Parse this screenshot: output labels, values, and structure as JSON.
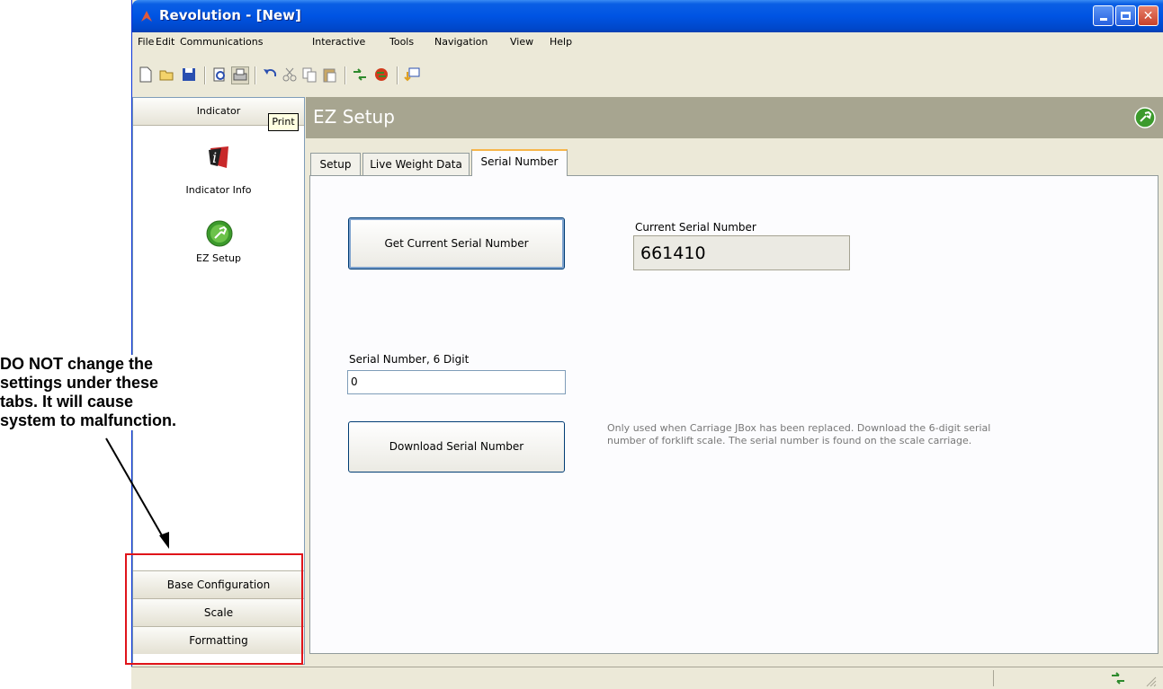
{
  "window": {
    "title": "Revolution - [New]",
    "controls": [
      "minimize",
      "maximize",
      "close"
    ]
  },
  "menu": [
    "File",
    "Edit",
    "Communications",
    "Interactive",
    "Tools",
    "Navigation",
    "View",
    "Help"
  ],
  "toolbar_icons": [
    "new-icon",
    "open-icon",
    "save-icon",
    "print-preview-icon",
    "print-icon",
    "undo-icon",
    "cut-icon",
    "copy-icon",
    "paste-icon",
    "connect-icon",
    "disconnect-icon",
    "download-icon"
  ],
  "tooltip": "Print",
  "nav": {
    "header": "Indicator",
    "items": [
      {
        "label": "Indicator Info",
        "icon": "indicator-info-icon"
      },
      {
        "label": "EZ Setup",
        "icon": "ez-setup-icon"
      }
    ],
    "bottom_buttons": [
      "Base Configuration",
      "Scale",
      "Formatting"
    ]
  },
  "main": {
    "title": "EZ Setup",
    "tabs": [
      "Setup",
      "Live Weight Data",
      "Serial Number"
    ],
    "active_tab": "Serial Number",
    "get_serial_button": "Get Current Serial Number",
    "current_serial_label": "Current Serial Number",
    "current_serial_value": "661410",
    "serial_input_label": "Serial Number, 6 Digit",
    "serial_input_value": "0",
    "download_button": "Download Serial Number",
    "help_text": "Only used when Carriage JBox has been replaced.  Download the 6-digit serial number of forklift scale. The serial number is found on the scale carriage."
  },
  "annotation": {
    "note": "DO NOT change the settings under these tabs. It will cause system to malfunction."
  }
}
